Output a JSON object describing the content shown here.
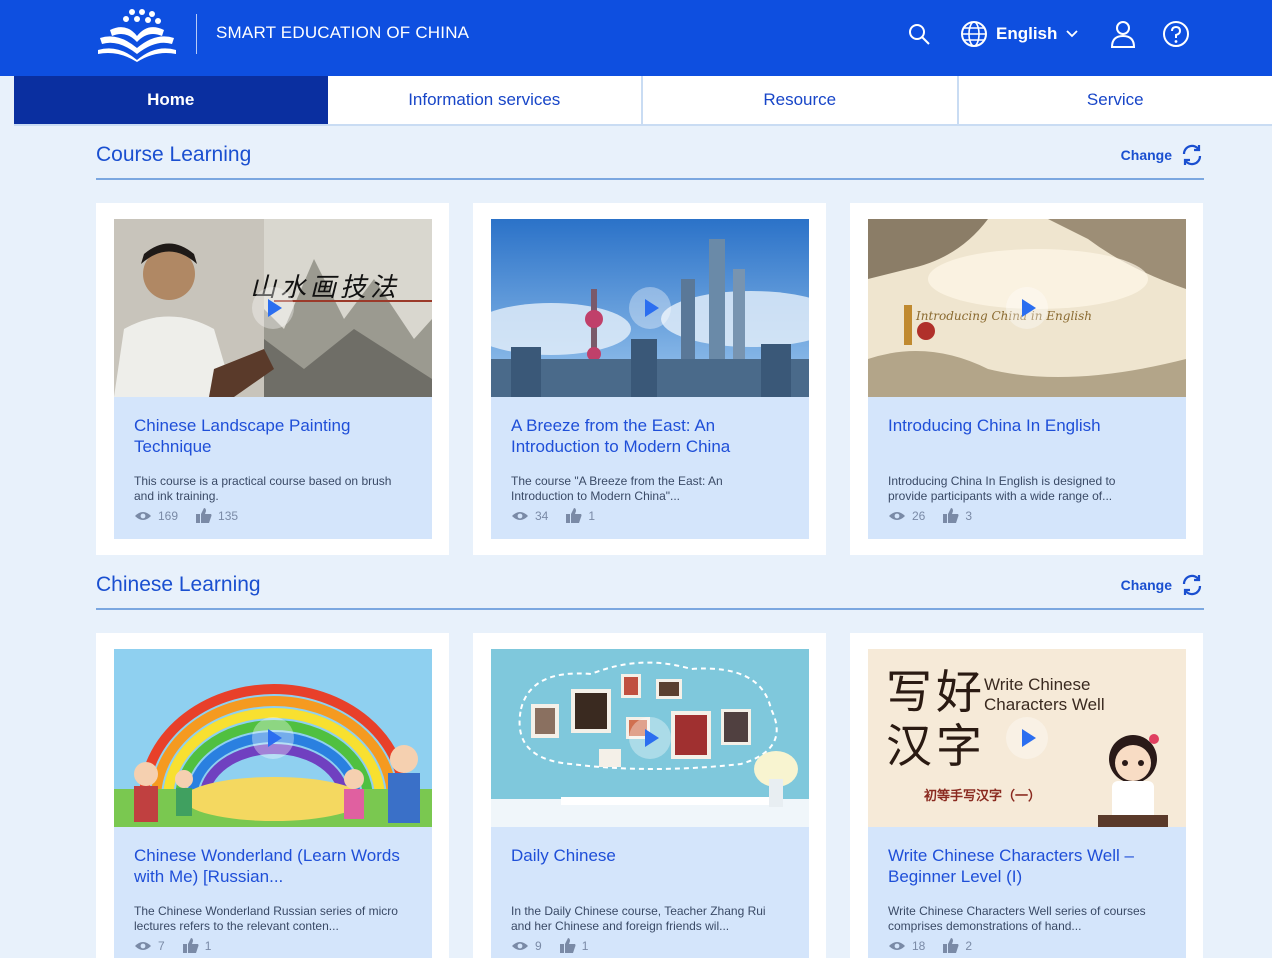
{
  "header": {
    "site_title": "SMART EDUCATION OF CHINA",
    "language": "English",
    "icons": [
      "logo-icon",
      "search-icon",
      "globe-icon",
      "chevron-down-icon",
      "user-icon",
      "help-icon"
    ]
  },
  "nav": {
    "tabs": [
      {
        "label": "Home",
        "active": true
      },
      {
        "label": "Information services",
        "active": false
      },
      {
        "label": "Resource",
        "active": false
      },
      {
        "label": "Service",
        "active": false
      }
    ]
  },
  "sections": [
    {
      "title": "Course Learning",
      "change_label": "Change",
      "cards": [
        {
          "title": "Chinese Landscape Painting Technique",
          "description": "This course is a practical course based on brush and ink training.",
          "views": "169",
          "likes": "135",
          "thumb_text": "山水画技法"
        },
        {
          "title": "A Breeze from the East: An Introduction to Modern China",
          "description": "The course \"A Breeze from the East: An Introduction to Modern China\"...",
          "views": "34",
          "likes": "1",
          "thumb_text": ""
        },
        {
          "title": "Introducing China In English",
          "description": "Introducing China In English is designed to provide participants with a wide range of...",
          "views": "26",
          "likes": "3",
          "thumb_text": "Introducing China in English"
        }
      ]
    },
    {
      "title": "Chinese Learning",
      "change_label": "Change",
      "cards": [
        {
          "title": "Chinese Wonderland (Learn Words with Me) [Russian...",
          "description": "The Chinese Wonderland Russian series of micro lectures refers to the relevant conten...",
          "views": "7",
          "likes": "1",
          "thumb_text": ""
        },
        {
          "title": "Daily Chinese",
          "description": "In the Daily Chinese course, Teacher Zhang Rui and her Chinese and foreign friends wil...",
          "views": "9",
          "likes": "1",
          "thumb_text": ""
        },
        {
          "title": "Write Chinese Characters Well – Beginner Level (I)",
          "description": "Write Chinese Characters Well series of courses comprises demonstrations of hand...",
          "views": "18",
          "likes": "2",
          "thumb_text": "Write Chinese Characters Well",
          "thumb_text_cn": "写好汉字",
          "thumb_subtext_cn": "初等手写汉字（一）"
        }
      ]
    }
  ],
  "colors": {
    "header_bg": "#0e4fe0",
    "nav_active_bg": "#0a2fa0",
    "page_bg": "#e8f1fb",
    "card_bg": "#d4e5fb",
    "accent_text": "#1f4fd8"
  }
}
